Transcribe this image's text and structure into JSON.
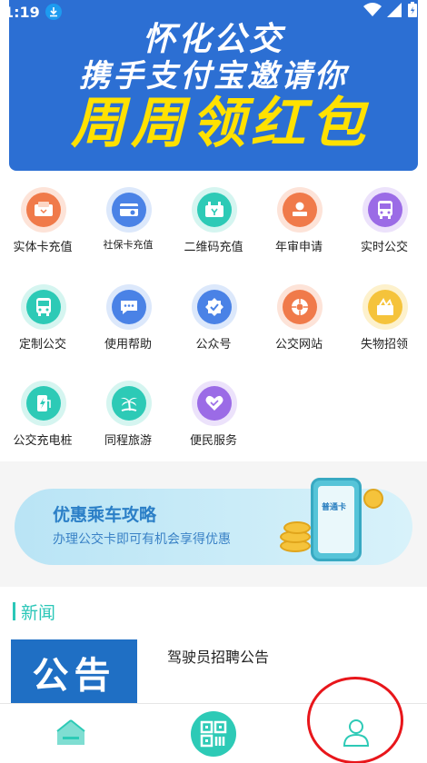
{
  "status_bar": {
    "time": "1:19",
    "download_icon": "download-icon",
    "right_icons": [
      "wifi-icon",
      "signal-icon",
      "battery-icon"
    ]
  },
  "banner": {
    "line1": "怀化公交",
    "line2": "携手支付宝邀请你",
    "line3": "周周领红包",
    "bg_color": "#2c6fd3",
    "highlight_color": "#ffe100"
  },
  "services": [
    {
      "label": "实体卡充值",
      "icon": "card-icon",
      "color": "#f07a4a",
      "ring": "#fde3d8"
    },
    {
      "label": "社保卡充值",
      "icon": "social-card-icon",
      "color": "#4a82e6",
      "ring": "#dce8fb"
    },
    {
      "label": "二维码充值",
      "icon": "qr-recharge-icon",
      "color": "#2dcab6",
      "ring": "#d5f5f0"
    },
    {
      "label": "年审申请",
      "icon": "review-icon",
      "color": "#f07a4a",
      "ring": "#fde3d8"
    },
    {
      "label": "实时公交",
      "icon": "bus-icon",
      "color": "#9b6be6",
      "ring": "#ece2fb"
    },
    {
      "label": "定制公交",
      "icon": "custom-bus-icon",
      "color": "#2dcab6",
      "ring": "#d5f5f0"
    },
    {
      "label": "使用帮助",
      "icon": "help-icon",
      "color": "#4a82e6",
      "ring": "#dce8fb"
    },
    {
      "label": "公众号",
      "icon": "official-account-icon",
      "color": "#4a82e6",
      "ring": "#dce8fb"
    },
    {
      "label": "公交网站",
      "icon": "website-icon",
      "color": "#f07a4a",
      "ring": "#fde3d8"
    },
    {
      "label": "失物招领",
      "icon": "lost-found-icon",
      "color": "#f5c33b",
      "ring": "#fdf1cc"
    },
    {
      "label": "公交充电桩",
      "icon": "charging-icon",
      "color": "#2dcab6",
      "ring": "#d5f5f0"
    },
    {
      "label": "同程旅游",
      "icon": "travel-icon",
      "color": "#2dcab6",
      "ring": "#d5f5f0"
    },
    {
      "label": "便民服务",
      "icon": "service-icon",
      "color": "#9b6be6",
      "ring": "#ece2fb"
    }
  ],
  "promo": {
    "title": "优惠乘车攻略",
    "subtitle": "办理公交卡即可有机会享得优惠",
    "card_label": "普通卡"
  },
  "news": {
    "section_title": "新闻",
    "items": [
      {
        "thumb_text": "公告",
        "title": "驾驶员招聘公告"
      }
    ]
  },
  "tabbar": {
    "items": [
      "home-icon",
      "qr-code-icon",
      "profile-icon"
    ],
    "accent": "#2dcab6"
  }
}
